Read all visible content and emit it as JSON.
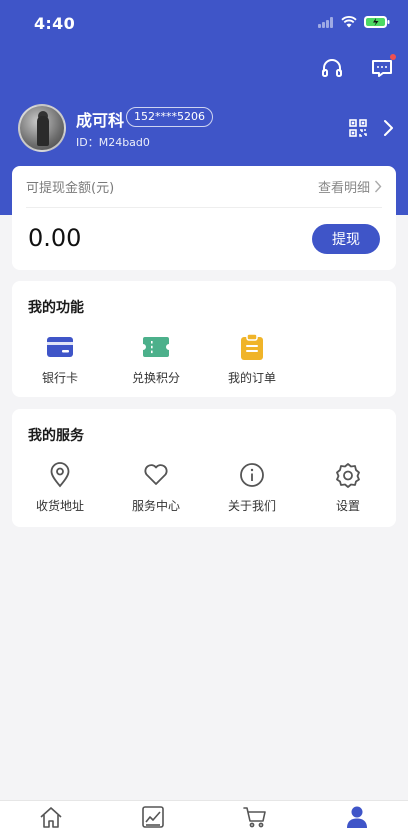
{
  "status_bar": {
    "time": "4:40"
  },
  "colors": {
    "brand": "#3f55c8",
    "bank_icon": "#3f55c8",
    "points_icon": "#4cb08b",
    "order_icon": "#f0b429"
  },
  "header": {
    "icons": [
      "headset-icon",
      "message-icon"
    ]
  },
  "profile": {
    "name": "成可科",
    "phone": "152****5206",
    "id_text": "ID：M24bad0"
  },
  "wallet": {
    "label": "可提现金额(元)",
    "detail_link": "查看明细",
    "amount": "0.00",
    "withdraw_button": "提现"
  },
  "functions": {
    "title": "我的功能",
    "items": [
      {
        "label": "银行卡",
        "icon": "bank-card-icon"
      },
      {
        "label": "兑换积分",
        "icon": "ticket-icon"
      },
      {
        "label": "我的订单",
        "icon": "clipboard-icon"
      }
    ]
  },
  "services": {
    "title": "我的服务",
    "items": [
      {
        "label": "收货地址",
        "icon": "location-pin-icon"
      },
      {
        "label": "服务中心",
        "icon": "heart-icon"
      },
      {
        "label": "关于我们",
        "icon": "info-icon"
      },
      {
        "label": "设置",
        "icon": "gear-icon"
      }
    ]
  },
  "tabbar": {
    "tabs": [
      {
        "icon": "home-icon"
      },
      {
        "icon": "chart-icon"
      },
      {
        "icon": "cart-icon"
      },
      {
        "icon": "user-icon",
        "active": true
      }
    ]
  }
}
